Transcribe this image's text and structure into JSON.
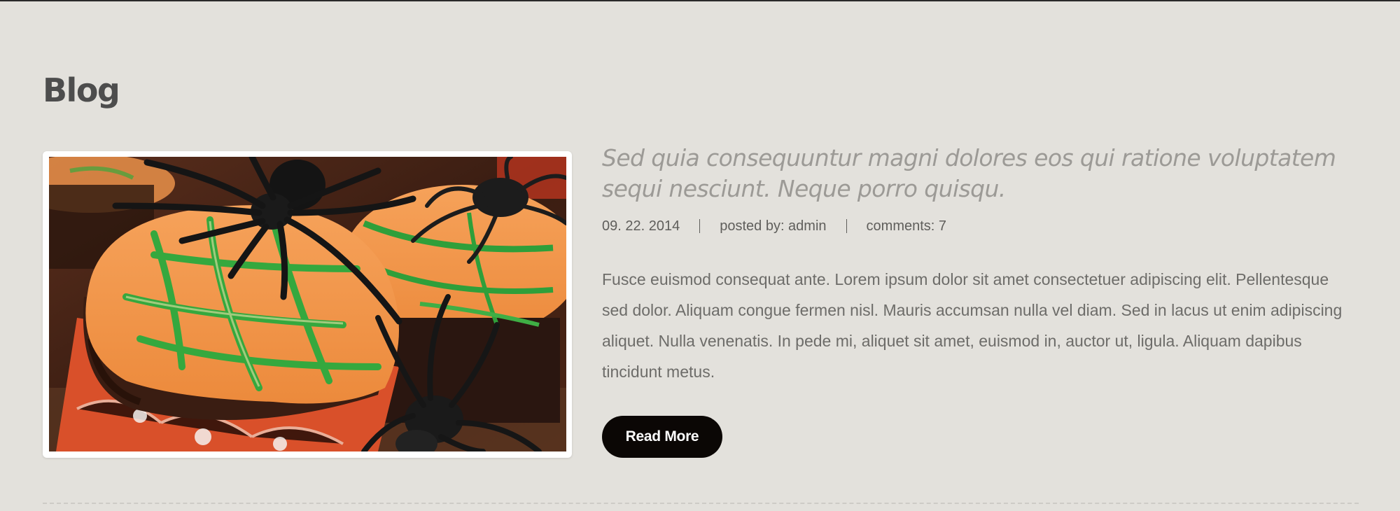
{
  "page": {
    "title": "Blog"
  },
  "post": {
    "image_alt": "Halloween cupcakes with orange frosting, green web icing and plastic spiders",
    "title": "Sed quia consequuntur magni dolores eos qui ratione voluptatem sequi nesciunt. Neque porro quisqu.",
    "meta": {
      "date": "09. 22. 2014",
      "author": "posted by: admin",
      "comments": "comments: 7"
    },
    "excerpt": "Fusce euismod consequat ante. Lorem ipsum dolor sit amet consectetuer adipiscing elit. Pellentesque sed dolor. Aliquam congue fermen nisl. Mauris accumsan nulla vel diam. Sed in lacus ut enim adipiscing aliquet. Nulla venenatis. In pede mi, aliquet sit amet, euismod in, auctor ut, ligula. Aliquam dapibus tincidunt metus.",
    "read_more_label": "Read More"
  },
  "colors": {
    "background": "#e3e1dc",
    "heading": "#4d4d4d",
    "post_title": "#9c9a96",
    "body_text": "#6d6c69",
    "button_bg": "#0b0705",
    "button_text": "#ffffff"
  }
}
